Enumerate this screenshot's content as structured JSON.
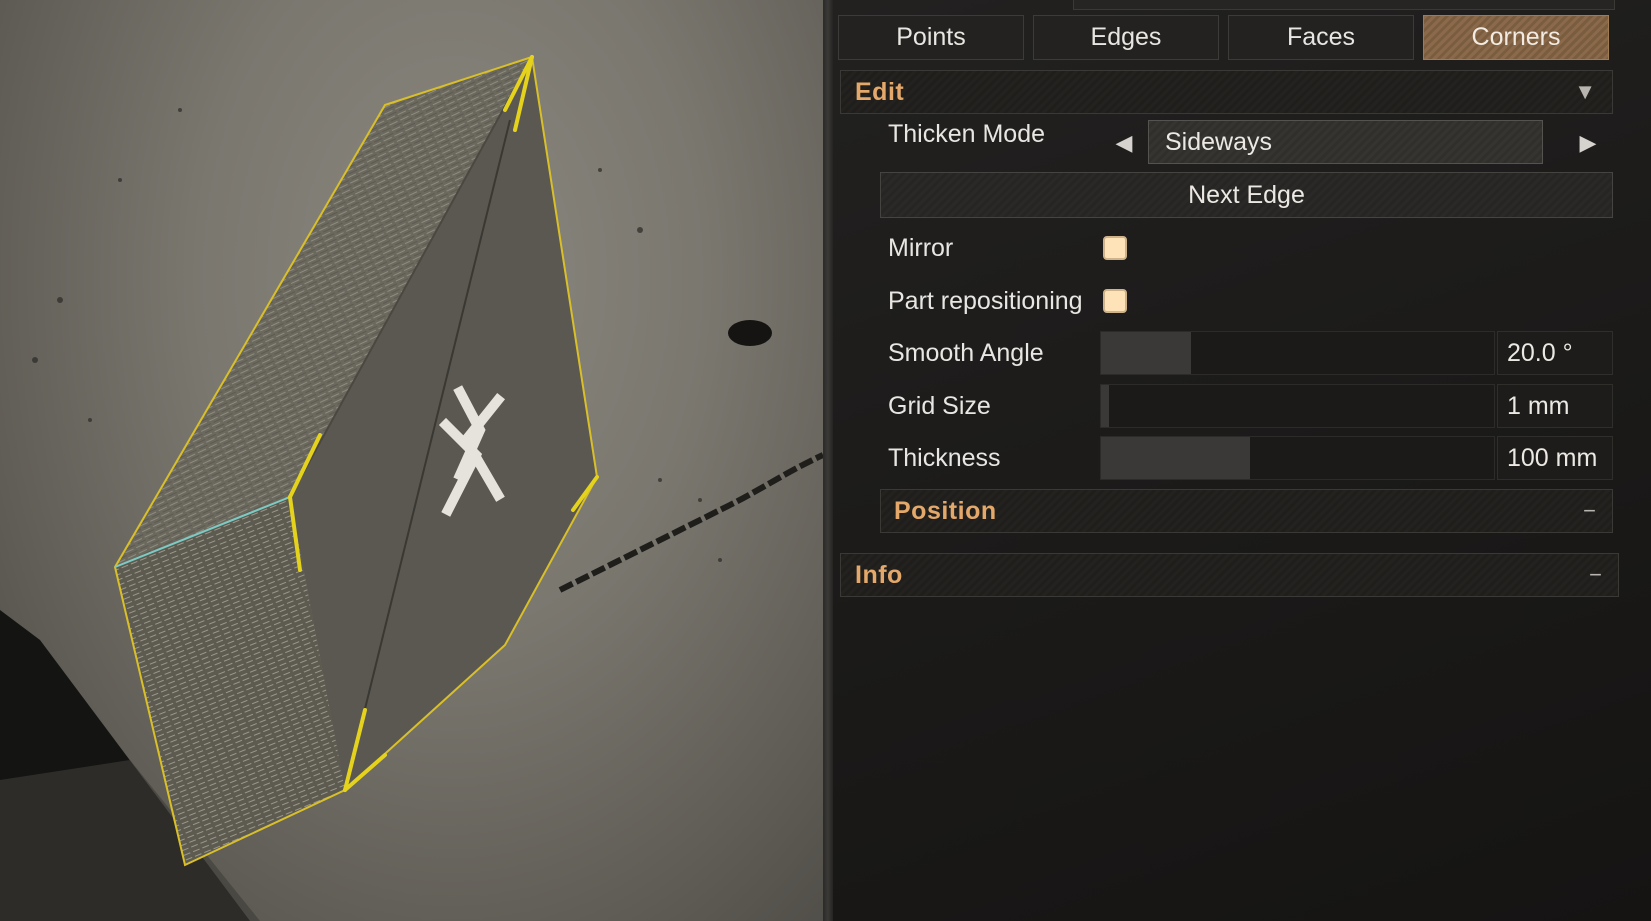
{
  "tabs": [
    {
      "label": "Points",
      "active": false
    },
    {
      "label": "Edges",
      "active": false
    },
    {
      "label": "Faces",
      "active": false
    },
    {
      "label": "Corners",
      "active": true
    }
  ],
  "edit": {
    "title": "Edit",
    "indicator": "▼",
    "thicken_mode": {
      "label": "Thicken Mode",
      "value": "Sideways",
      "prev": "◀",
      "next": "▶"
    },
    "next_edge_label": "Next Edge",
    "mirror": {
      "label": "Mirror",
      "checked": true
    },
    "part_repositioning": {
      "label": "Part repositioning",
      "checked": true
    },
    "smooth_angle": {
      "label": "Smooth Angle",
      "value": "20.0 °",
      "fill": 0.23
    },
    "grid_size": {
      "label": "Grid Size",
      "value": "1 mm",
      "fill": 0.02
    },
    "thickness": {
      "label": "Thickness",
      "value": "100 mm",
      "fill": 0.38
    }
  },
  "position": {
    "title": "Position",
    "indicator": "−"
  },
  "info": {
    "title": "Info",
    "indicator": "−"
  },
  "colors": {
    "accent": "#e3a86a",
    "active_tab": "#8a6a4a",
    "selection": "#e5d21c",
    "checkbox": "#ffe3b8"
  },
  "viewport": {
    "object_icon": "hexagonal-prism-with-x-logo"
  }
}
